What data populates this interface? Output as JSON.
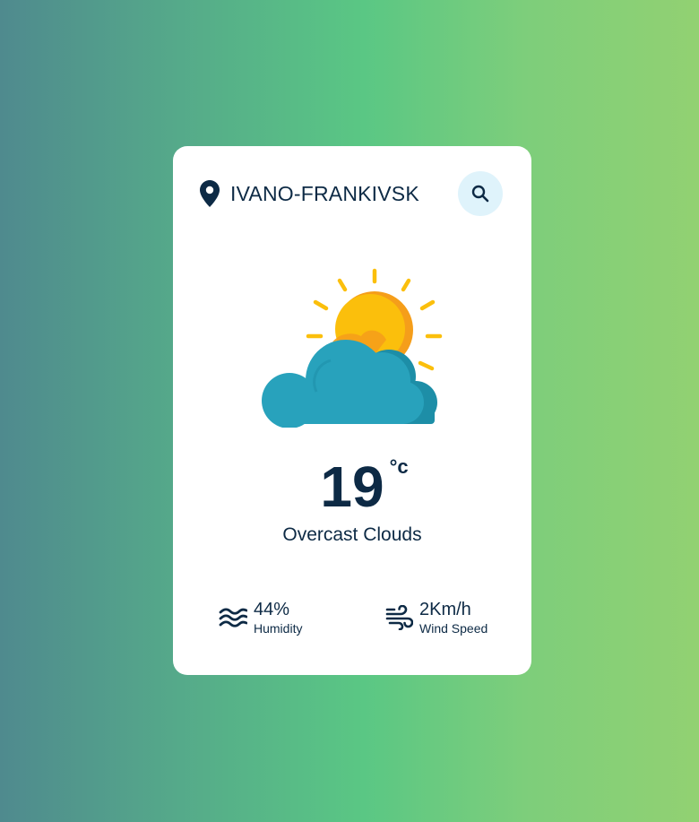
{
  "location": {
    "city": "IVANO-FRANKIVSK",
    "icon": "map-pin-icon"
  },
  "search": {
    "icon": "search-icon",
    "label": "Search"
  },
  "weather": {
    "icon": "partly-cloudy-sun-icon",
    "temperature": "19",
    "unit": "°c",
    "description": "Overcast Clouds"
  },
  "stats": {
    "humidity": {
      "icon": "waves-icon",
      "value": "44%",
      "label": "Humidity"
    },
    "wind": {
      "icon": "wind-icon",
      "value": "2Km/h",
      "label": "Wind Speed"
    }
  },
  "colors": {
    "text": "#0d2a45",
    "card": "#ffffff",
    "search_bg": "#dff3fb",
    "sun": "#fbbf0c",
    "sun_shade": "#f59e1a",
    "cloud": "#28a2bc",
    "cloud_shade": "#1d8ea7"
  }
}
